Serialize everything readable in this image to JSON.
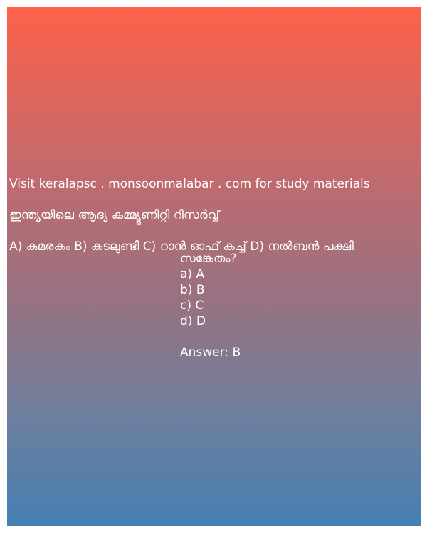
{
  "visit_text": "Visit keralapsc . monsoonmalabar . com for study materials",
  "question": "ഇന്ത്യയിലെ ആദ്യ കമ്മ്യൂണിറ്റി റിസർവ്വ്",
  "options_line": "A) കുമരകം  B) കടലുണ്ടി  C) റാൻ ഓഫ് കച്ച്  D) നൽബൻ പക്ഷി",
  "options_line_cont": "സങ്കേതം?",
  "choices": {
    "a": "a) A",
    "b": "b) B",
    "c": "c) C",
    "d": "d) D"
  },
  "answer": "Answer: B"
}
